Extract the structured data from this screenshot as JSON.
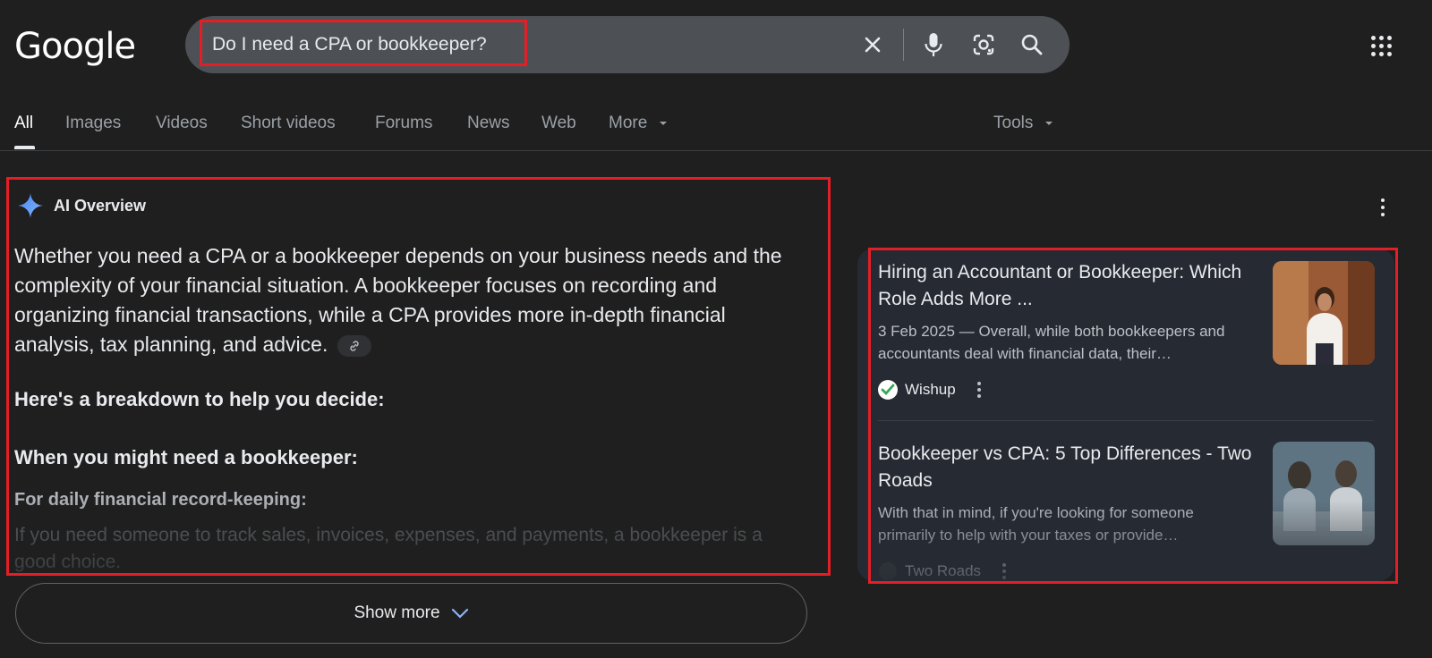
{
  "header": {
    "logo_text": "Google",
    "search_query": "Do I need a CPA or bookkeeper?"
  },
  "tabs": [
    {
      "label": "All",
      "active": true
    },
    {
      "label": "Images"
    },
    {
      "label": "Videos"
    },
    {
      "label": "Short videos"
    },
    {
      "label": "Forums"
    },
    {
      "label": "News"
    },
    {
      "label": "Web"
    },
    {
      "label": "More"
    }
  ],
  "tools_label": "Tools",
  "ai_overview": {
    "title": "AI Overview",
    "intro": "Whether you need a CPA or a bookkeeper depends on your business needs and the complexity of your financial situation. A bookkeeper focuses on recording and organizing financial transactions, while a CPA provides more in-depth financial analysis, tax planning, and advice.",
    "breakdown_heading": "Here's a breakdown to help you decide:",
    "section_heading": "When you might need a bookkeeper:",
    "sub_heading": "For daily financial record-keeping:",
    "faded_text": "If you need someone to track sales, invoices, expenses, and payments, a bookkeeper is a good choice.",
    "show_more_label": "Show more"
  },
  "sources": [
    {
      "title": "Hiring an Accountant or Bookkeeper: Which Role Adds More ...",
      "snippet": "3 Feb 2025 — Overall, while both bookkeepers and accountants deal with financial data, their…",
      "source": "Wishup"
    },
    {
      "title": "Bookkeeper vs CPA: 5 Top Differences - Two Roads",
      "snippet": "With that in mind, if you're looking for someone primarily to help with your taxes or provide…",
      "source": "Two Roads"
    }
  ],
  "colors": {
    "background": "#1f1f1f",
    "search_bar": "#4d5156",
    "highlight_border": "#e41e26",
    "side_panel": "#262a33",
    "ai_gem_blue": "#8ab4f8"
  }
}
